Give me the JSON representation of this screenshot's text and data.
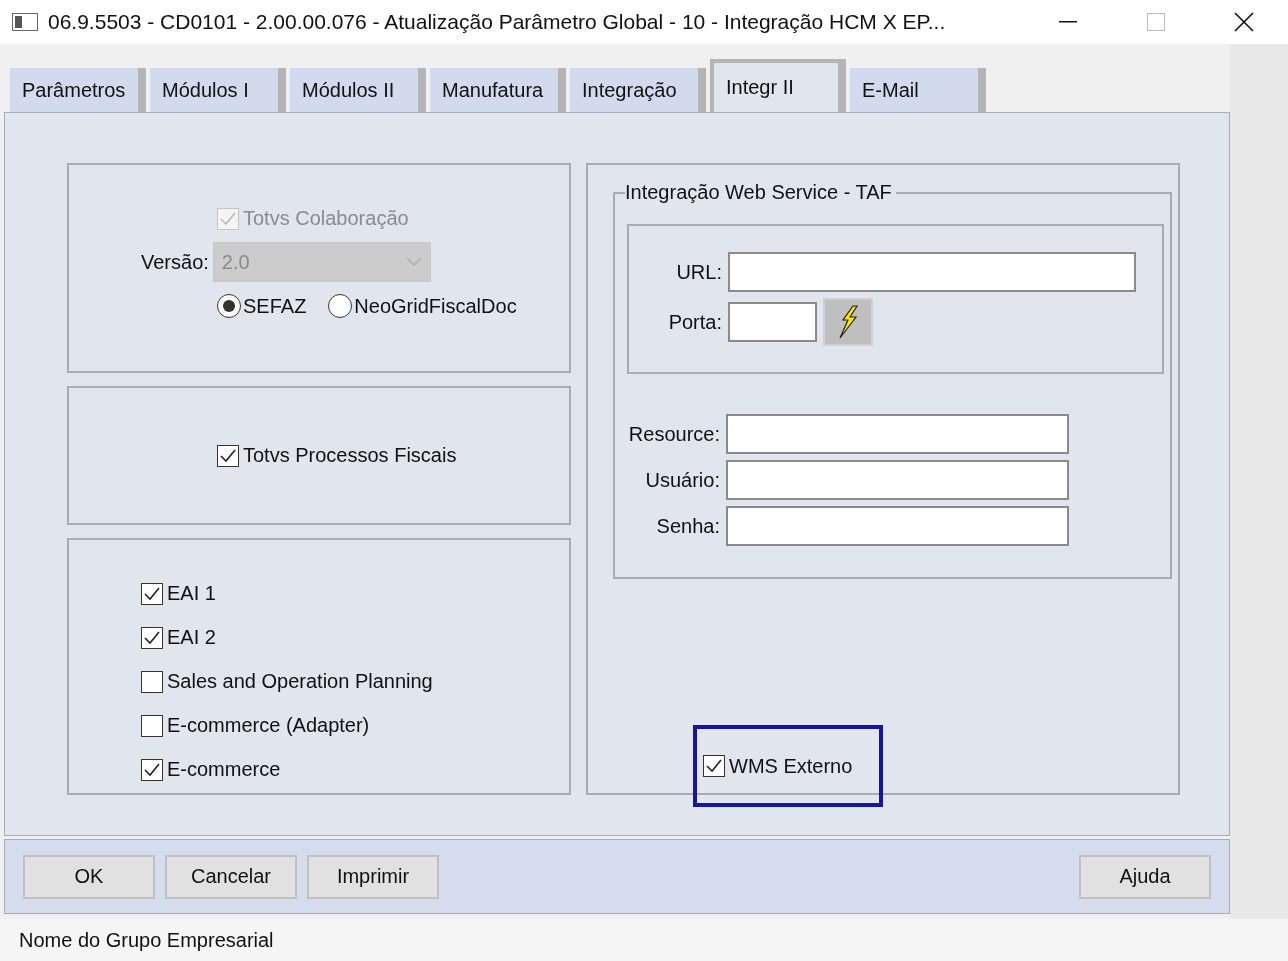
{
  "window": {
    "title": "06.9.5503 - CD0101 - 2.00.00.076 - Atualização Parâmetro Global - 10 - Integração HCM X EP..."
  },
  "tabs": [
    {
      "label": "Parâmetros",
      "selected": false
    },
    {
      "label": "Módulos I",
      "selected": false
    },
    {
      "label": "Módulos II",
      "selected": false
    },
    {
      "label": "Manufatura",
      "selected": false
    },
    {
      "label": "Integração",
      "selected": false
    },
    {
      "label": "Integr II",
      "selected": true
    },
    {
      "label": "E-Mail",
      "selected": false
    }
  ],
  "colaboracao": {
    "checkbox": {
      "label": "Totvs Colaboração",
      "checked": true,
      "disabled": true
    },
    "version": {
      "label": "Versão:",
      "value": "2.0",
      "disabled": true
    },
    "radios": [
      {
        "label": "SEFAZ",
        "selected": true
      },
      {
        "label": "NeoGridFiscalDoc",
        "selected": false
      }
    ]
  },
  "processos_fiscais": {
    "label": "Totvs Processos Fiscais",
    "checked": true,
    "disabled": false
  },
  "integrations": [
    {
      "label": "EAI 1",
      "checked": true,
      "disabled": false
    },
    {
      "label": "EAI 2",
      "checked": true,
      "disabled": false
    },
    {
      "label": "Sales and Operation Planning",
      "checked": false,
      "disabled": false
    },
    {
      "label": "E-commerce (Adapter)",
      "checked": false,
      "disabled": false
    },
    {
      "label": "E-commerce",
      "checked": true,
      "disabled": false
    }
  ],
  "web_service": {
    "title": "Integração Web Service - TAF",
    "connection_fields": [
      {
        "label": "URL:",
        "kind": "wide"
      },
      {
        "label": "Porta:",
        "kind": "port"
      }
    ],
    "credential_fields": [
      {
        "label": "Resource:"
      },
      {
        "label": "Usuário:"
      },
      {
        "label": "Senha:"
      }
    ]
  },
  "wms": {
    "label": "WMS Externo",
    "checked": true,
    "disabled": false,
    "highlighted": true
  },
  "buttons_left": [
    "OK",
    "Cancelar",
    "Imprimir"
  ],
  "buttons_right": [
    "Ajuda"
  ],
  "status_bar": "Nome do Grupo Empresarial"
}
